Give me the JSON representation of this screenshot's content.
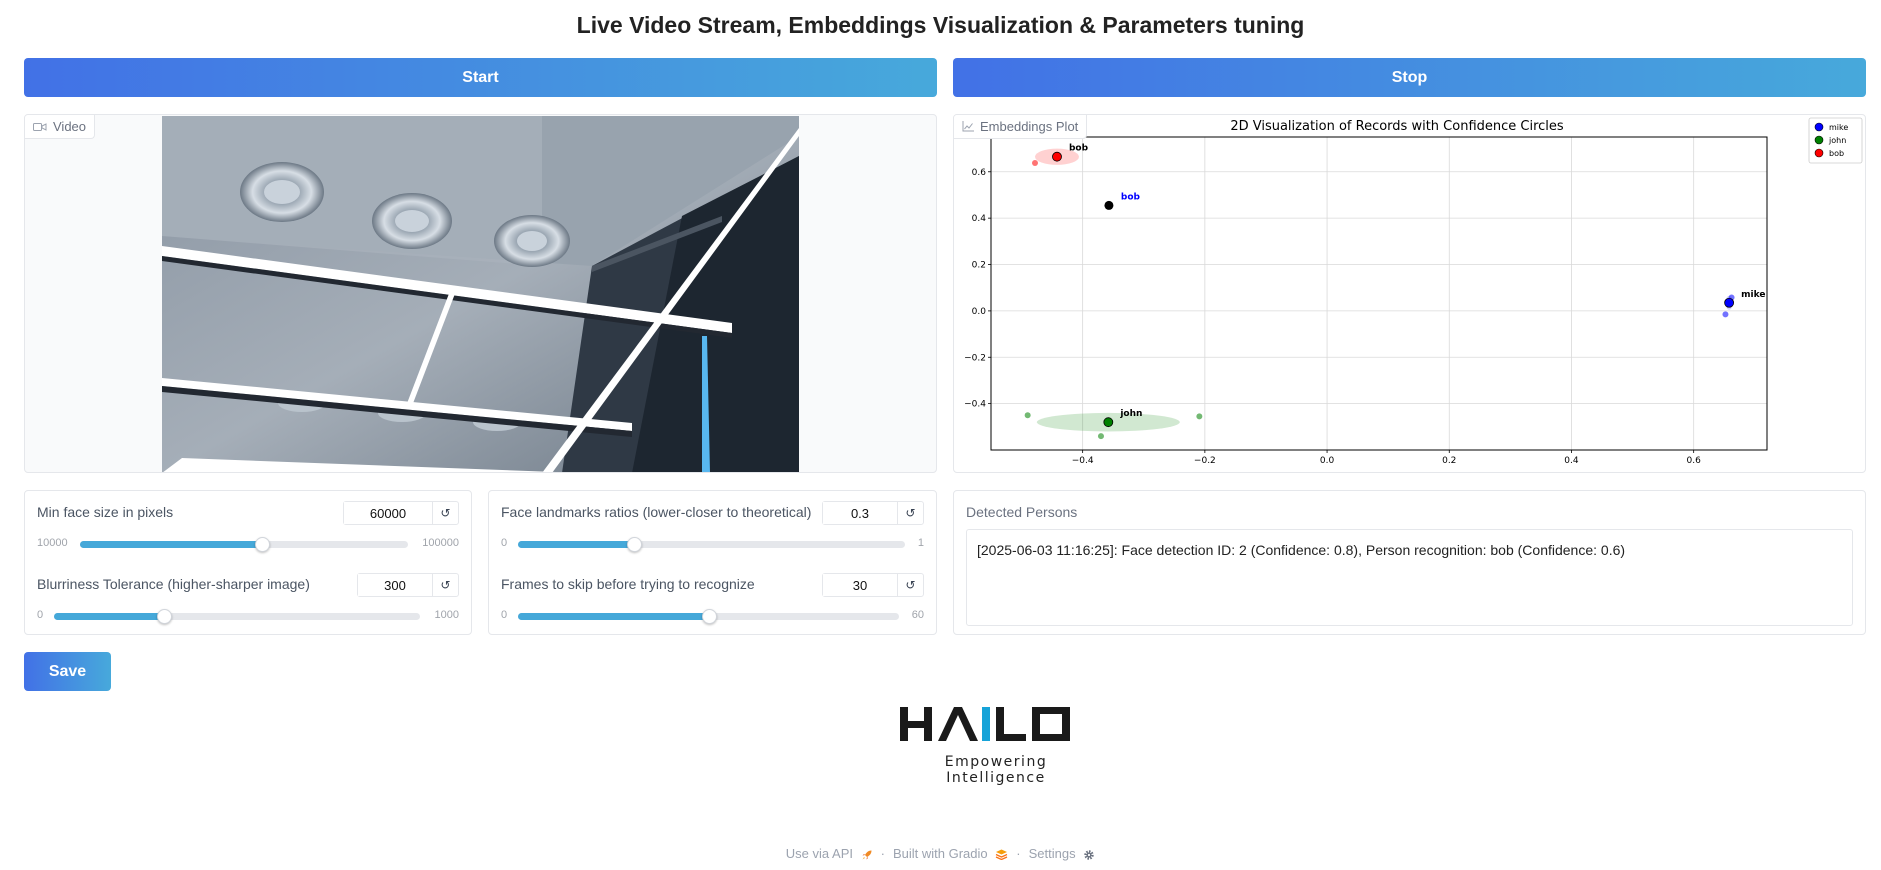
{
  "title": "Live Video Stream, Embeddings Visualization & Parameters tuning",
  "buttons": {
    "start": "Start",
    "stop": "Stop",
    "save": "Save"
  },
  "video": {
    "label": "Video"
  },
  "plot": {
    "label": "Embeddings Plot"
  },
  "controls": {
    "min_face": {
      "label": "Min face size in pixels",
      "value": "60000",
      "min": "10000",
      "max": "100000",
      "fraction": 0.556
    },
    "landmarks": {
      "label": "Face landmarks ratios (lower-closer to theoretical)",
      "value": "0.3",
      "min": "0",
      "max": "1",
      "fraction": 0.3
    },
    "blur": {
      "label": "Blurriness Tolerance (higher-sharper image)",
      "value": "300",
      "min": "0",
      "max": "1000",
      "fraction": 0.3
    },
    "frames": {
      "label": "Frames to skip before trying to recognize",
      "value": "30",
      "min": "0",
      "max": "60",
      "fraction": 0.5
    },
    "reset_glyph": "↺"
  },
  "detected": {
    "label": "Detected Persons",
    "text": "[2025-06-03 11:16:25]: Face detection ID: 2 (Confidence: 0.8), Person recognition: bob (Confidence: 0.6)"
  },
  "logo": {
    "text": "HAILO",
    "tagline": "Empowering Intelligence"
  },
  "footer": {
    "api": "Use via API",
    "built": "Built with Gradio",
    "settings": "Settings",
    "sep": "·"
  },
  "icons": {
    "video": "video-camera-icon",
    "plot": "chart-icon",
    "api": "rocket-icon",
    "gradio": "gradio-logo-icon",
    "settings": "gear-icon",
    "reset": "reset-icon"
  },
  "colors": {
    "accent_start": "#4271e6",
    "accent_end": "#47a9db",
    "logo_blue": "#16a3d8"
  },
  "chart_data": {
    "type": "scatter",
    "title": "2D Visualization of Records with Confidence Circles",
    "xlabel": "",
    "ylabel": "",
    "xlim": [
      -0.55,
      0.72
    ],
    "ylim": [
      -0.6,
      0.75
    ],
    "x_ticks": [
      -0.4,
      -0.2,
      0.0,
      0.2,
      0.4,
      0.6
    ],
    "x_tick_labels": [
      "−0.4",
      "−0.2",
      "0.0",
      "0.2",
      "0.4",
      "0.6"
    ],
    "y_ticks": [
      -0.4,
      -0.2,
      0.0,
      0.2,
      0.4,
      0.6
    ],
    "y_tick_labels": [
      "−0.4",
      "−0.2",
      "0.0",
      "0.2",
      "0.4",
      "0.6"
    ],
    "grid": true,
    "legend_position": "outside-top-right",
    "series": [
      {
        "name": "mike",
        "color": "#0000ff",
        "centroid": [
          0.658,
          0.035
        ],
        "points": [
          [
            0.662,
            0.058
          ],
          [
            0.657,
            0.035
          ],
          [
            0.652,
            -0.015
          ]
        ],
        "ellipse_rx": 0.006,
        "ellipse_ry": 0.03,
        "label": "mike"
      },
      {
        "name": "john",
        "color": "#008000",
        "centroid": [
          -0.358,
          -0.48
        ],
        "points": [
          [
            -0.49,
            -0.45
          ],
          [
            -0.37,
            -0.54
          ],
          [
            -0.209,
            -0.455
          ]
        ],
        "ellipse_rx": 0.117,
        "ellipse_ry": 0.04,
        "label": "john"
      },
      {
        "name": "bob",
        "color": "#ff0000",
        "centroid": [
          -0.442,
          0.665
        ],
        "points": [
          [
            -0.478,
            0.638
          ]
        ],
        "ellipse_rx": 0.036,
        "ellipse_ry": 0.035,
        "label": "bob"
      }
    ],
    "query_point": {
      "label": "bob",
      "x": -0.357,
      "y": 0.455,
      "color": "#000000",
      "label_color": "#0000ff"
    }
  }
}
